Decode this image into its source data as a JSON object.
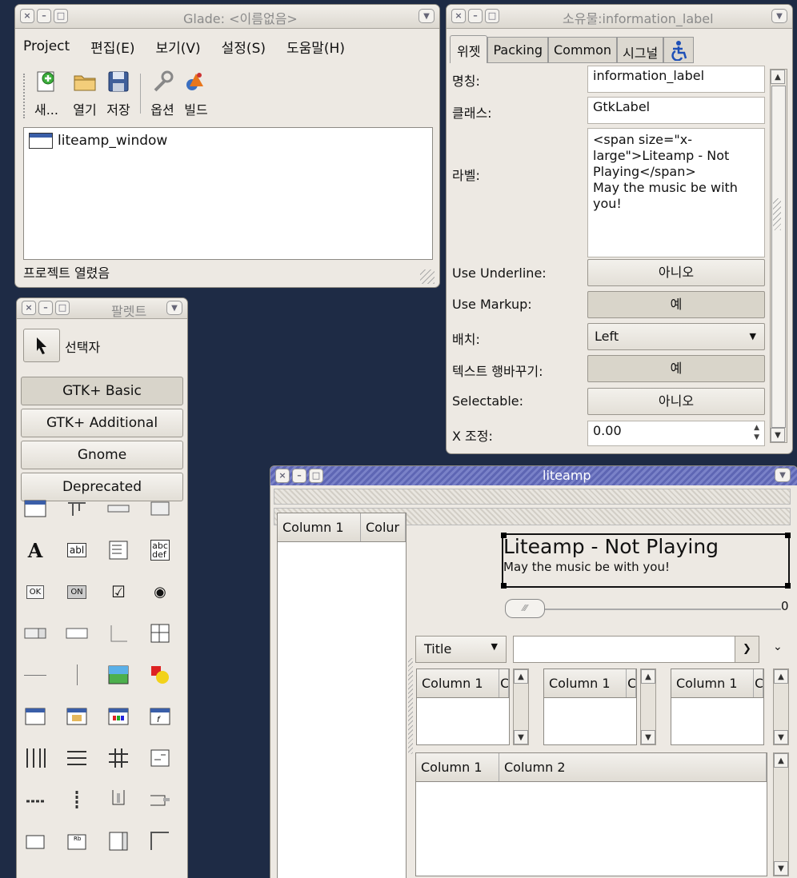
{
  "glade_window": {
    "title": "Glade: <이름없음>",
    "menu": [
      {
        "label": "Project",
        "key": "P"
      },
      {
        "label": "편집(E)",
        "key": "E"
      },
      {
        "label": "보기(V)",
        "key": "V"
      },
      {
        "label": "설정(S)",
        "key": "S"
      },
      {
        "label": "도움말(H)",
        "key": "H"
      }
    ],
    "toolbar": {
      "new": "새...",
      "open": "열기",
      "save": "저장",
      "options": "옵션",
      "build": "빌드"
    },
    "tree_item": "liteamp_window",
    "status": "프로젝트 열렸음"
  },
  "palette_window": {
    "title": "팔렛트",
    "selector": "선택자",
    "groups": [
      "GTK+ Basic",
      "GTK+ Additional",
      "Gnome",
      "Deprecated"
    ]
  },
  "properties_window": {
    "title": "소유물:information_label",
    "tabs": [
      "위젯",
      "Packing",
      "Common",
      "시그널"
    ],
    "rows": {
      "name_label": "명칭:",
      "name_value": "information_label",
      "class_label": "클래스:",
      "class_value": "GtkLabel",
      "label_label": "라벨:",
      "label_value": "<span size=\"x-large\">Liteamp - Not Playing</span>\nMay the music be with you!",
      "underline_label": "Use Underline:",
      "underline_value": "아니오",
      "markup_label": "Use Markup:",
      "markup_value": "예",
      "justify_label": "배치:",
      "justify_value": "Left",
      "wrap_label": "텍스트 행바꾸기:",
      "wrap_value": "예",
      "selectable_label": "Selectable:",
      "selectable_value": "아니오",
      "xalign_label": "X 조정:",
      "xalign_value": "0.00"
    }
  },
  "liteamp_window": {
    "title": "liteamp",
    "left_list_cols": [
      "Column 1",
      "Colur"
    ],
    "big_label": "Liteamp - Not Playing",
    "small_label": "May the music be with you!",
    "slider_value": "0",
    "combo_selected": "Title",
    "mini_lists": [
      [
        "Column 1",
        "C"
      ],
      [
        "Column 1",
        "C"
      ],
      [
        "Column 1",
        "C"
      ]
    ],
    "bottom_list_cols": [
      "Column 1",
      "Column 2"
    ]
  }
}
